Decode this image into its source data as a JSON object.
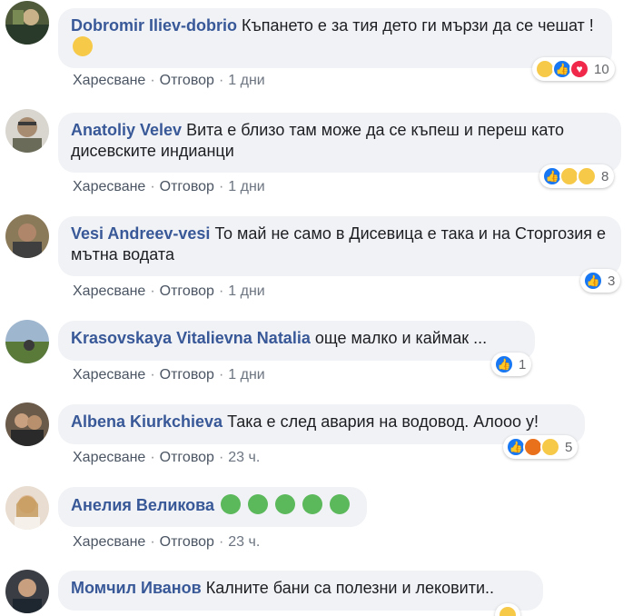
{
  "labels": {
    "like": "Харесване",
    "reply": "Отговор",
    "dot": "·"
  },
  "comments": [
    {
      "author": "Dobromir Iliev-dobrio",
      "text": "Къпането е за тия дето ги мързи да се чешат !",
      "time": "1 дни",
      "reactions_count": "10",
      "reaction_icons": [
        "haha-icon",
        "like-icon",
        "love-icon"
      ],
      "emoji": "rofl-emoji"
    },
    {
      "author": "Anatoliy Velev",
      "text": "Вита е близо там може да се къпеш и переш като дисевските индианци",
      "time": "1 дни",
      "reactions_count": "8",
      "reaction_icons": [
        "like-icon",
        "haha-icon",
        "sad-icon"
      ]
    },
    {
      "author": "Vesi Andreev-vesi",
      "text": "То май не само в Дисевица е така и на Сторгозия е мътна водата",
      "time": "1 дни",
      "reactions_count": "3",
      "reaction_icons": [
        "like-icon"
      ]
    },
    {
      "author": "Krasovskaya Vitalievna Natalia",
      "text": "още малко и каймак ...",
      "time": "1 дни",
      "reactions_count": "1",
      "reaction_icons": [
        "like-icon"
      ]
    },
    {
      "author": "Albena Kiurkchieva",
      "text": "Така е след авария на водовод. Алооо у!",
      "time": "23 ч.",
      "reactions_count": "5",
      "reaction_icons": [
        "like-icon",
        "angry-icon",
        "haha-icon"
      ]
    },
    {
      "author": "Анелия Великова",
      "text": "",
      "time": "23 ч.",
      "emoji": "nauseated-face-emoji x5"
    },
    {
      "author": "Момчил Иванов",
      "text": "Калните бани са полезни и лековити..",
      "time": "",
      "reaction_icons": [
        "sad-icon"
      ]
    }
  ]
}
